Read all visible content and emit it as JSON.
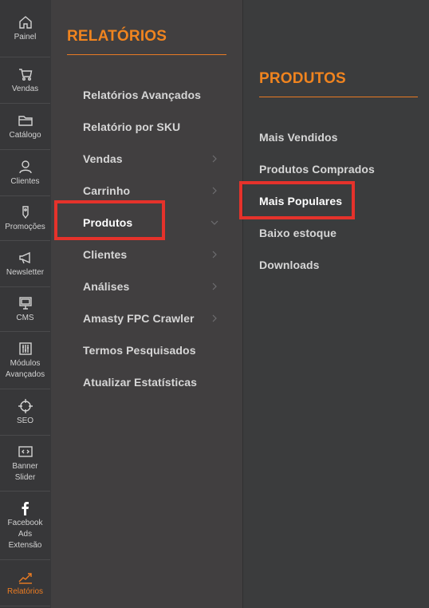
{
  "rail": {
    "items": [
      {
        "label": "Painel",
        "icon": "home-icon"
      },
      {
        "label": "Vendas",
        "icon": "cart-icon"
      },
      {
        "label": "Catálogo",
        "icon": "folder-icon"
      },
      {
        "label": "Clientes",
        "icon": "person-icon"
      },
      {
        "label": "Promoções",
        "icon": "tag-icon"
      },
      {
        "label": "Newsletter",
        "icon": "megaphone-icon"
      },
      {
        "label": "CMS",
        "icon": "monitor-icon"
      },
      {
        "label": "Módulos\nAvançados",
        "icon": "sliders-icon"
      },
      {
        "label": "SEO",
        "icon": "target-icon"
      },
      {
        "label": "Banner\nSlider",
        "icon": "code-icon"
      },
      {
        "label": "Facebook\nAds\nExtensão",
        "icon": "facebook-icon"
      },
      {
        "label": "Relatórios",
        "icon": "chart-icon",
        "active": true
      }
    ]
  },
  "panel1": {
    "title": "RELATÓRIOS",
    "items": [
      {
        "label": "Relatórios Avançados"
      },
      {
        "label": "Relatório por SKU"
      },
      {
        "label": "Vendas",
        "icon": "chevron-right-icon"
      },
      {
        "label": "Carrinho",
        "icon": "chevron-right-icon"
      },
      {
        "label": "Produtos",
        "icon": "chevron-down-icon",
        "highlighted": true
      },
      {
        "label": "Clientes",
        "icon": "chevron-right-icon"
      },
      {
        "label": "Análises",
        "icon": "chevron-right-icon"
      },
      {
        "label": "Amasty FPC Crawler",
        "icon": "chevron-right-icon"
      },
      {
        "label": "Termos Pesquisados"
      },
      {
        "label": "Atualizar Estatísticas"
      }
    ]
  },
  "panel2": {
    "title": "PRODUTOS",
    "items": [
      {
        "label": "Mais Vendidos"
      },
      {
        "label": "Produtos Comprados"
      },
      {
        "label": "Mais Populares",
        "highlighted": true
      },
      {
        "label": "Baixo estoque"
      },
      {
        "label": "Downloads"
      }
    ]
  },
  "colors": {
    "accent": "#f0841f",
    "highlight": "#e5322b",
    "rail_bg": "#373739",
    "panel1_bg": "#413f40",
    "panel2_bg": "#3b3c3d"
  }
}
